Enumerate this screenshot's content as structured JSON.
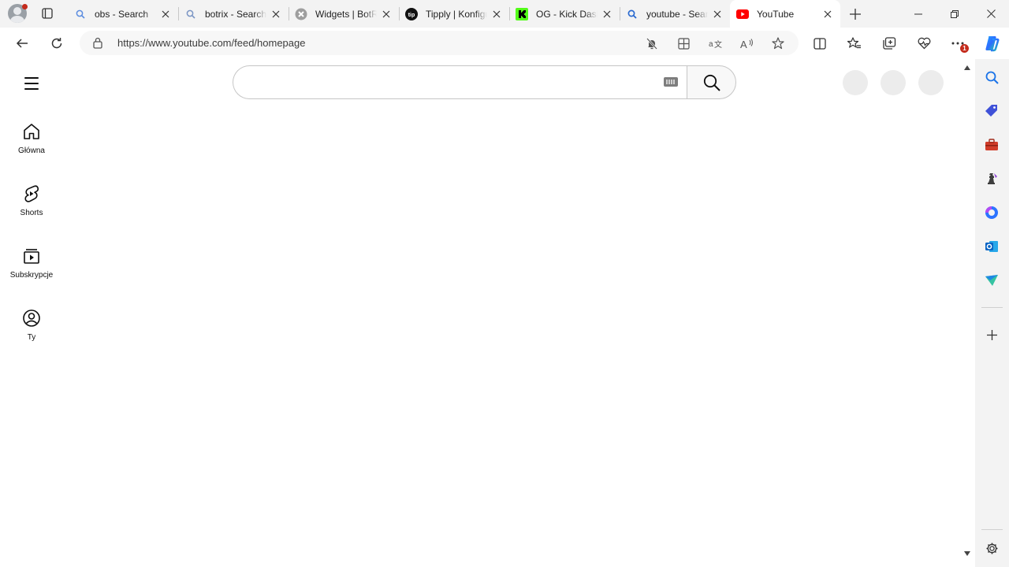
{
  "browser": {
    "tabs": [
      {
        "title": "obs - Search",
        "icon": "search-icon"
      },
      {
        "title": "botrix - Search",
        "icon": "search-icon"
      },
      {
        "title": "Widgets | BotRix",
        "icon": "botrix-logo-icon"
      },
      {
        "title": "Tipply | Konfiguracja",
        "icon": "tipply-logo-icon"
      },
      {
        "title": "OG - Kick Dashboard",
        "icon": "kick-logo-icon"
      },
      {
        "title": "youtube - Search",
        "icon": "search-icon"
      },
      {
        "title": "YouTube",
        "icon": "youtube-logo-icon",
        "active": true
      }
    ],
    "address": {
      "url": "https://www.youtube.com/feed/homepage"
    },
    "notification_badge": "1",
    "colors": {
      "youtube_red": "#ff0000",
      "kick_green": "#53fc18",
      "badge_red": "#c42b1c"
    }
  },
  "youtube": {
    "search": {
      "value": "",
      "placeholder": ""
    },
    "nav": [
      {
        "label": "Główna",
        "icon": "home-icon"
      },
      {
        "label": "Shorts",
        "icon": "shorts-icon"
      },
      {
        "label": "Subskrypcje",
        "icon": "subscriptions-icon"
      },
      {
        "label": "Ty",
        "icon": "account-icon"
      }
    ]
  }
}
